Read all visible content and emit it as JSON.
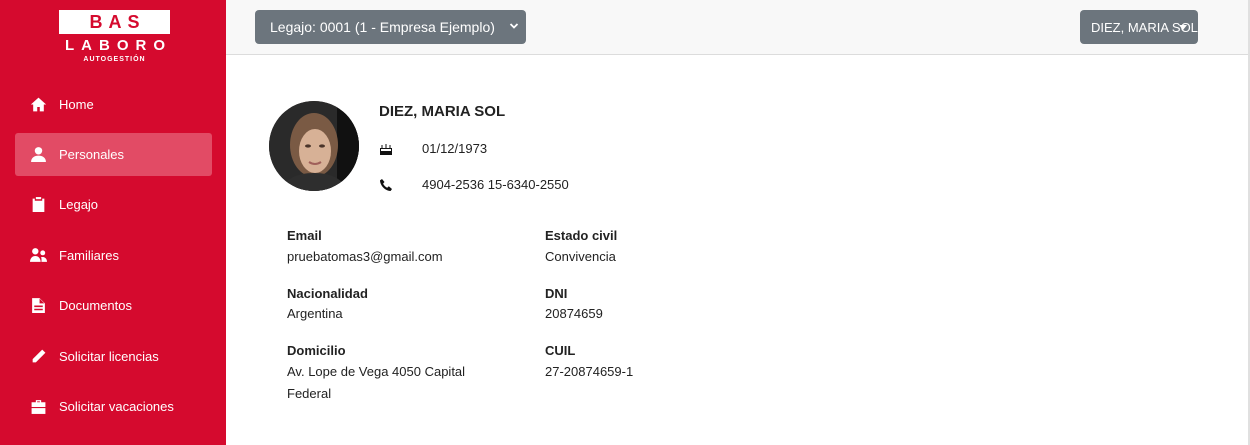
{
  "logo": {
    "line1": "BAS",
    "line2": "LABORO",
    "line3": "AUTOGESTIÓN"
  },
  "sidebar": {
    "items": [
      {
        "label": "Home",
        "icon": "home-icon"
      },
      {
        "label": "Personales",
        "icon": "user-icon",
        "active": true
      },
      {
        "label": "Legajo",
        "icon": "clipboard-icon"
      },
      {
        "label": "Familiares",
        "icon": "family-icon"
      },
      {
        "label": "Documentos",
        "icon": "document-icon"
      },
      {
        "label": "Solicitar licencias",
        "icon": "pencil-icon"
      },
      {
        "label": "Solicitar vacaciones",
        "icon": "briefcase-icon"
      }
    ]
  },
  "topbar": {
    "legajo_select": "Legajo: 0001 (1 - Empresa Ejemplo)",
    "user_menu": "DIEZ, MARIA SOL"
  },
  "profile": {
    "name": "DIEZ, MARIA SOL",
    "birth_date": "01/12/1973",
    "phone": "4904-2536 15-6340-2550"
  },
  "fields": {
    "email_label": "Email",
    "email": "pruebatomas3@gmail.com",
    "estado_civil_label": "Estado civil",
    "estado_civil": "Convivencia",
    "nacionalidad_label": "Nacionalidad",
    "nacionalidad": "Argentina",
    "dni_label": "DNI",
    "dni": "20874659",
    "domicilio_label": "Domicilio",
    "domicilio_line1": "Av. Lope de Vega 4050 Capital",
    "domicilio_line2": "Federal",
    "cuil_label": "CUIL",
    "cuil": "27-20874659-1"
  },
  "colors": {
    "brand": "#d50a2e",
    "active_item": "#e24b65",
    "button": "#6c757d"
  }
}
